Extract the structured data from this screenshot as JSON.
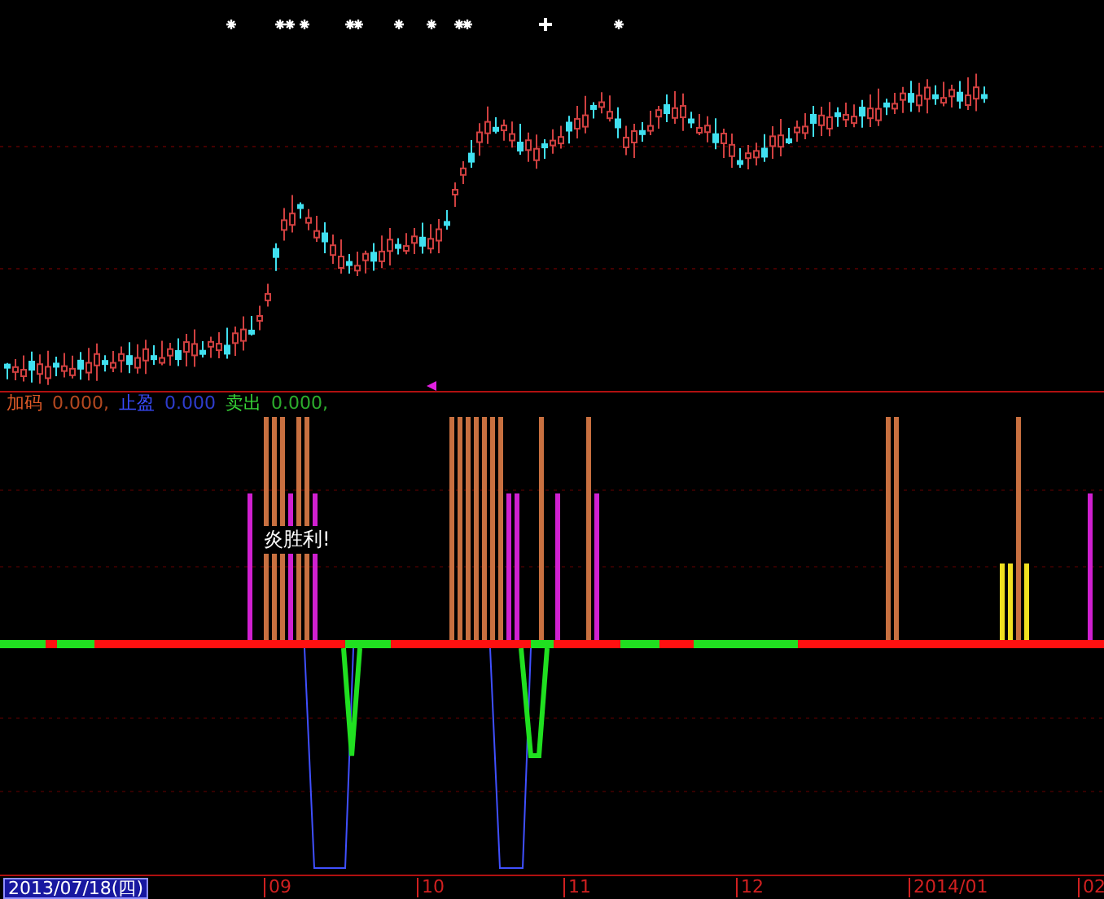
{
  "legend": [
    {
      "label": "加码",
      "value": "0.000,",
      "color": "#e05a28"
    },
    {
      "label": "止盈",
      "value": "0.000",
      "color": "#3a4cff"
    },
    {
      "label": "卖出",
      "value": "0.000,",
      "color": "#38d838"
    }
  ],
  "annotation": "炎胜利!",
  "x_axis": {
    "current_date": "2013/07/18(四)",
    "labels": [
      "09",
      "10",
      "11",
      "12",
      "2014/01",
      "02"
    ]
  }
}
